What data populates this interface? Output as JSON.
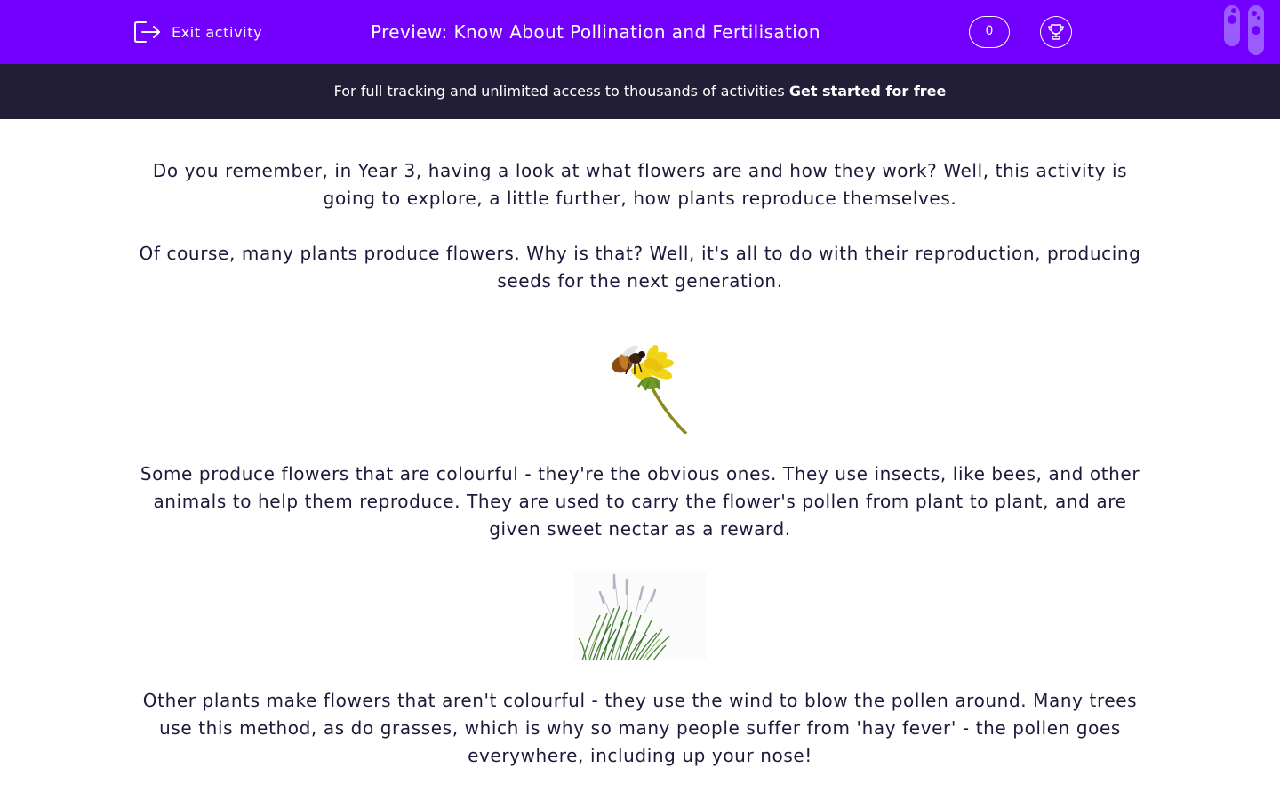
{
  "header": {
    "exit_label": "Exit activity",
    "title": "Preview: Know About Pollination and Fertilisation",
    "score": "0",
    "icons": {
      "exit": "exit-icon",
      "trophy": "trophy-icon",
      "logo": "test-tubes-logo"
    },
    "colors": {
      "header_bg": "#7300ff",
      "banner_bg": "#231e38",
      "text": "#1c1a3a"
    }
  },
  "banner": {
    "text": "For full tracking and unlimited access to thousands of activities ",
    "cta": "Get started for free"
  },
  "content": {
    "paragraph_1": "Do you remember, in Year 3, having a look at what flowers are and how they work? Well, this activity is going to explore, a little further, how plants reproduce themselves.",
    "paragraph_2": "Of course, many plants produce flowers.  Why is that?  Well, it's all to do with their reproduction, producing seeds for the next generation.",
    "paragraph_3": "Some produce flowers that are colourful - they're the obvious ones.  They use insects, like bees, and other animals to help them reproduce.  They are used to carry the flower's pollen from plant to plant, and are given sweet nectar as a reward.",
    "paragraph_4": "Other plants make flowers that aren't colourful - they use the wind to blow the pollen around.  Many trees use this method, as do grasses, which is why so many people suffer from 'hay fever' - the pollen goes everywhere, including up your nose!"
  }
}
